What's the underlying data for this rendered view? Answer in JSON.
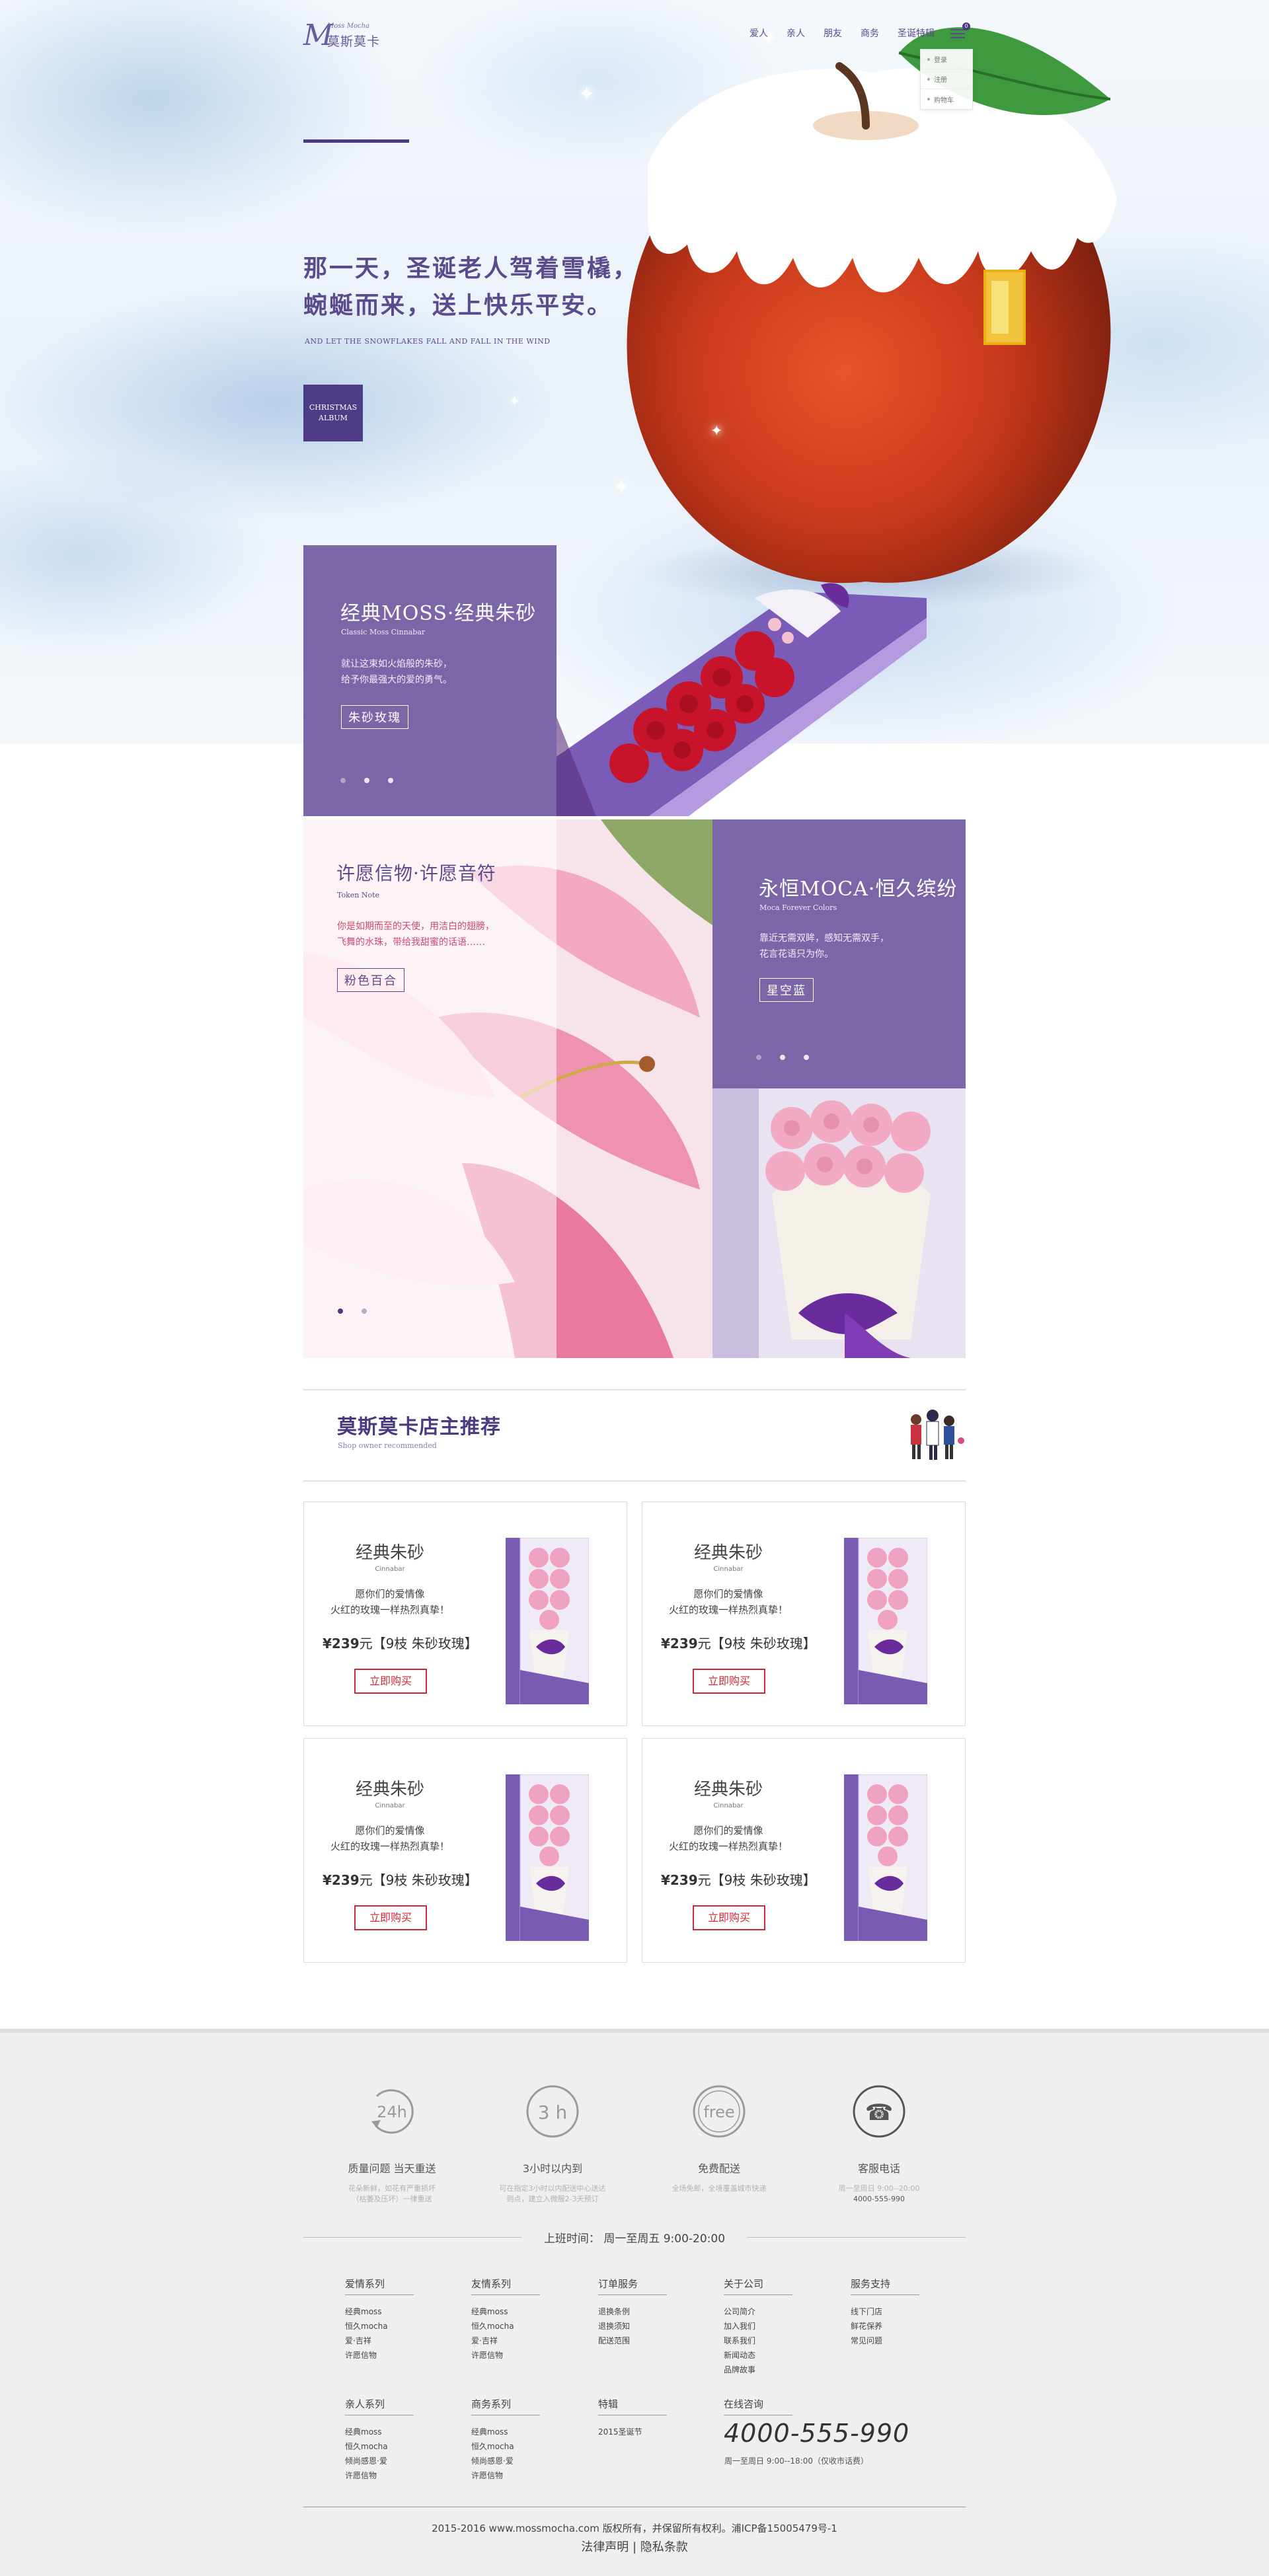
{
  "brand": {
    "mark": "M",
    "script": "Moss Mocha",
    "name": "莫斯莫卡"
  },
  "nav": [
    "爱人",
    "亲人",
    "朋友",
    "商务",
    "圣诞特辑"
  ],
  "menu": {
    "badge": "0",
    "items": [
      "登录",
      "注册",
      "购物车"
    ]
  },
  "hero": {
    "title_line1": "那一天，圣诞老人驾着雪橇，",
    "title_line2": "蜿蜒而来，送上快乐平安。",
    "subtitle": "AND LET THE SNOWFLAKES FALL AND FALL IN THE WIND",
    "album_line1": "CHRISTMAS",
    "album_line2": "ALBUM"
  },
  "promo": {
    "classic": {
      "title": "经典MOSS·经典朱砂",
      "en": "Classic Moss Cinnabar",
      "desc1": "就让这束如火焰般的朱砂，",
      "desc2": "给予你最强大的爱的勇气。",
      "button": "朱砂玫瑰"
    },
    "token": {
      "title": "许愿信物·许愿音符",
      "en": "Token Note",
      "desc1": "你是如期而至的天使，用洁白的翅膀，",
      "desc2": "飞舞的水珠，带给我甜蜜的话语……",
      "button": "粉色百合"
    },
    "moca": {
      "title": "永恒MOCA·恒久缤纷",
      "en": "Moca Forever Colors",
      "desc1": "靠近无需双眸，感知无需双手，",
      "desc2": "花言花语只为你。",
      "button": "星空蓝"
    }
  },
  "recommend": {
    "title": "莫斯莫卡店主推荐",
    "subtitle": "Shop owner recommended"
  },
  "products": [
    {
      "name": "经典朱砂",
      "en": "Cinnabar",
      "line1": "愿你们的爱情像",
      "line2": "火红的玫瑰一样热烈真挚！",
      "price": "¥239",
      "price_note": "元【9枝 朱砂玫瑰】",
      "button": "立即购买"
    },
    {
      "name": "经典朱砂",
      "en": "Cinnabar",
      "line1": "愿你们的爱情像",
      "line2": "火红的玫瑰一样热烈真挚！",
      "price": "¥239",
      "price_note": "元【9枝 朱砂玫瑰】",
      "button": "立即购买"
    },
    {
      "name": "经典朱砂",
      "en": "Cinnabar",
      "line1": "愿你们的爱情像",
      "line2": "火红的玫瑰一样热烈真挚！",
      "price": "¥239",
      "price_note": "元【9枝 朱砂玫瑰】",
      "button": "立即购买"
    },
    {
      "name": "经典朱砂",
      "en": "Cinnabar",
      "line1": "愿你们的爱情像",
      "line2": "火红的玫瑰一样热烈真挚！",
      "price": "¥239",
      "price_note": "元【9枝 朱砂玫瑰】",
      "button": "立即购买"
    }
  ],
  "services": [
    {
      "icon": "24h-icon",
      "glyph": "24h",
      "title": "质量问题 当天重送",
      "desc1": "花朵新鲜，如花有严重损坏",
      "desc2": "（枯萎及压坏）一律重送"
    },
    {
      "icon": "3h-icon",
      "glyph": "3 h",
      "title": "3小时以内到",
      "desc1": "可在指定3小时以内配送中心送达",
      "desc2": "则点，建立入微服2-3天预订"
    },
    {
      "icon": "free-shipping-icon",
      "glyph": "free",
      "title": "免费配送",
      "desc1": "全场免邮，全境覆盖城市快递",
      "desc2": ""
    },
    {
      "icon": "phone-icon",
      "glyph": "☎",
      "title": "客服电话",
      "desc1": "周一至周日 9:00--20:00",
      "desc2": "4000-555-990"
    }
  ],
  "hours": "上班时间：  周一至周五  9:00-20:00",
  "footer_cols_row1": [
    {
      "heading": "爱情系列",
      "items": [
        "经典moss",
        "恒久mocha",
        "爱·吉祥",
        "许愿信物"
      ]
    },
    {
      "heading": "友情系列",
      "items": [
        "经典moss",
        "恒久mocha",
        "爱·吉祥",
        "许愿信物"
      ]
    },
    {
      "heading": "订单服务",
      "items": [
        "退换条例",
        "退换须知",
        "配送范围"
      ]
    },
    {
      "heading": "关于公司",
      "items": [
        "公司简介",
        "加入我们",
        "联系我们",
        "新闻动态",
        "品牌故事"
      ]
    },
    {
      "heading": "服务支持",
      "items": [
        "线下门店",
        "鲜花保养",
        "常见问题"
      ]
    }
  ],
  "footer_cols_row2": [
    {
      "heading": "亲人系列",
      "items": [
        "经典moss",
        "恒久mocha",
        "倾尚感恩·爱",
        "许愿信物"
      ]
    },
    {
      "heading": "商务系列",
      "items": [
        "经典moss",
        "恒久mocha",
        "倾尚感恩·爱",
        "许愿信物"
      ]
    },
    {
      "heading": "特辑",
      "items": [
        "2015圣诞节"
      ]
    },
    {
      "heading": "在线咨询",
      "items": []
    }
  ],
  "contact": {
    "phone": "4000-555-990",
    "hours": "周一至周日 9:00--18:00（仅收市话费）"
  },
  "copyright": "2015-2016 www.mossmocha.com 版权所有，并保留所有权利。浦ICP备15005479号-1",
  "legal": {
    "terms": "法律声明",
    "sep": "|",
    "privacy": "隐私条款"
  },
  "colors": {
    "brand": "#5b4a8c",
    "violet": "#7b66a8",
    "accent_red": "#c62c3a",
    "footer_bg": "#efefef"
  }
}
